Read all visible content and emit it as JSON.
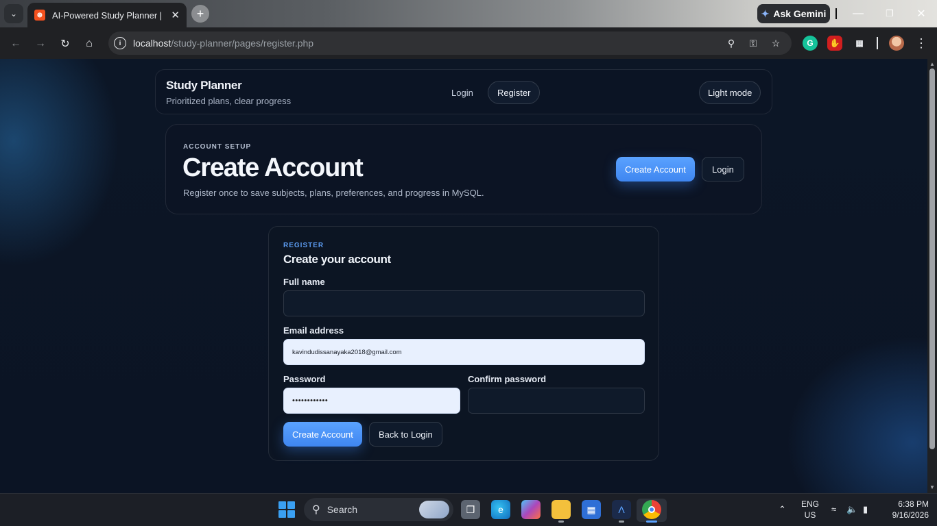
{
  "browser": {
    "tab_title": "AI-Powered Study Planner | Reg",
    "url_host": "localhost",
    "url_path": "/study-planner/pages/register.php",
    "gemini_label": "Ask Gemini"
  },
  "header": {
    "brand_title": "Study Planner",
    "brand_subtitle": "Prioritized plans, clear progress",
    "nav": {
      "login": "Login",
      "register": "Register"
    },
    "theme_toggle": "Light mode"
  },
  "hero": {
    "eyebrow": "ACCOUNT SETUP",
    "title": "Create Account",
    "description": "Register once to save subjects, plans, preferences, and progress in MySQL.",
    "primary_button": "Create Account",
    "secondary_button": "Login"
  },
  "form": {
    "eyebrow": "REGISTER",
    "title": "Create your account",
    "full_name": {
      "label": "Full name",
      "value": ""
    },
    "email": {
      "label": "Email address",
      "value": "kavindudissanayaka2018@gmail.com"
    },
    "password": {
      "label": "Password",
      "value": "••••••••••••"
    },
    "confirm_password": {
      "label": "Confirm password",
      "value": ""
    },
    "submit_button": "Create Account",
    "back_button": "Back to Login"
  },
  "taskbar": {
    "search_label": "Search",
    "language": "ENG",
    "region": "US",
    "time": "6:38 PM",
    "date": "9/16/2026"
  },
  "colors": {
    "accent": "#4a93f8",
    "page_bg": "#0c1626",
    "panel_bg": "#0c1524",
    "autofill_bg": "#e8f0fe"
  }
}
